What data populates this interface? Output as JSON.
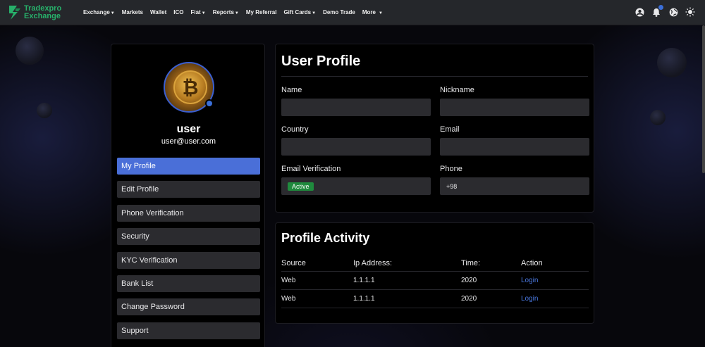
{
  "brand": {
    "line1": "Tradexpro",
    "line2": "Exchange",
    "color": "#27b06a"
  },
  "nav": {
    "items": [
      {
        "label": "Exchange",
        "caret": true
      },
      {
        "label": "Markets",
        "caret": false
      },
      {
        "label": "Wallet",
        "caret": false
      },
      {
        "label": "ICO",
        "caret": false
      },
      {
        "label": "Fiat",
        "caret": true
      },
      {
        "label": "Reports",
        "caret": true
      },
      {
        "label": "My Referral",
        "caret": false
      },
      {
        "label": "Gift Cards",
        "caret": true
      },
      {
        "label": "Demo Trade",
        "caret": false
      },
      {
        "label": "More",
        "caret": true
      }
    ],
    "icons": [
      "user-icon",
      "bell-icon",
      "globe-icon",
      "sun-icon"
    ]
  },
  "user": {
    "name": "user",
    "email": "user@user.com"
  },
  "sidebar": {
    "items": [
      {
        "label": "My Profile",
        "active": true
      },
      {
        "label": "Edit Profile"
      },
      {
        "label": "Phone Verification"
      },
      {
        "label": "Security"
      },
      {
        "label": "KYC Verification"
      },
      {
        "label": "Bank List"
      },
      {
        "label": "Change Password"
      },
      {
        "label": "Support"
      }
    ]
  },
  "profile": {
    "title": "User Profile",
    "fields": {
      "name": {
        "label": "Name",
        "value": ""
      },
      "nickname": {
        "label": "Nickname",
        "value": ""
      },
      "country": {
        "label": "Country",
        "value": ""
      },
      "email": {
        "label": "Email",
        "value": ""
      },
      "email_verification": {
        "label": "Email Verification",
        "status": "Active"
      },
      "phone": {
        "label": "Phone",
        "value": "+98"
      }
    }
  },
  "activity": {
    "title": "Profile Activity",
    "columns": [
      "Source",
      "Ip Address:",
      "Time:",
      "Action"
    ],
    "rows": [
      {
        "source": "Web",
        "ip": "1.1.1.1",
        "time": "2020",
        "action": "Login"
      },
      {
        "source": "Web",
        "ip": "1.1.1.1",
        "time": "2020",
        "action": "Login"
      }
    ]
  },
  "colors": {
    "accent": "#4a6fd8",
    "success": "#1f8a3d",
    "link": "#4a78e0"
  }
}
